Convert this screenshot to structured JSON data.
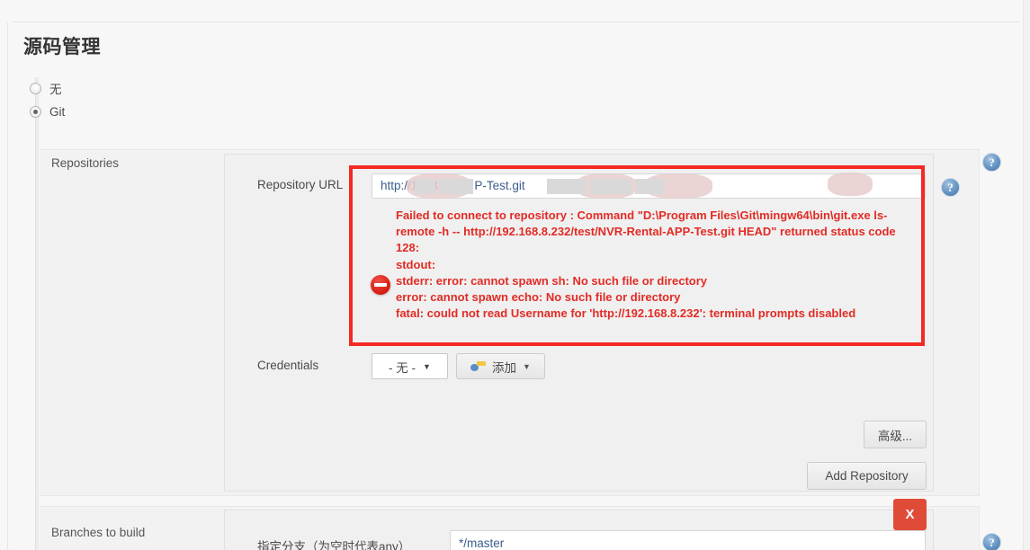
{
  "section": {
    "title": "源码管理"
  },
  "scm_options": [
    {
      "label": "无",
      "selected": false
    },
    {
      "label": "Git",
      "selected": true
    }
  ],
  "repositories": {
    "label": "Repositories",
    "repository_url": {
      "label": "Repository URL",
      "value": "http://19            .32/test/                     P-Test.git"
    },
    "credentials": {
      "label": "Credentials",
      "selected": "- 无 -",
      "add_button": "添加"
    },
    "advanced_button": "高级...",
    "add_repository_button": "Add Repository"
  },
  "error": {
    "icon": "error-stop-icon",
    "message": "Failed to connect to repository : Command \"D:\\Program Files\\Git\\mingw64\\bin\\git.exe ls-remote -h -- http://192.168.8.232/test/NVR-Rental-APP-Test.git HEAD\" returned status code 128:\nstdout:\nstderr: error: cannot spawn sh: No such file or directory\nerror: cannot spawn echo: No such file or directory\nfatal: could not read Username for 'http://192.168.8.232': terminal prompts disabled",
    "color": "#e22b25"
  },
  "branches": {
    "label": "Branches to build",
    "branch_spec_label": "指定分支（为空时代表any）",
    "branch_spec_value": "*/master",
    "delete_button": "X"
  },
  "help": {
    "glyph": "?"
  },
  "colors": {
    "highlight_red": "#f42a23",
    "delete_red": "#e04b38",
    "error_red": "#e22b25",
    "help_blue": "#3f6fa3"
  }
}
